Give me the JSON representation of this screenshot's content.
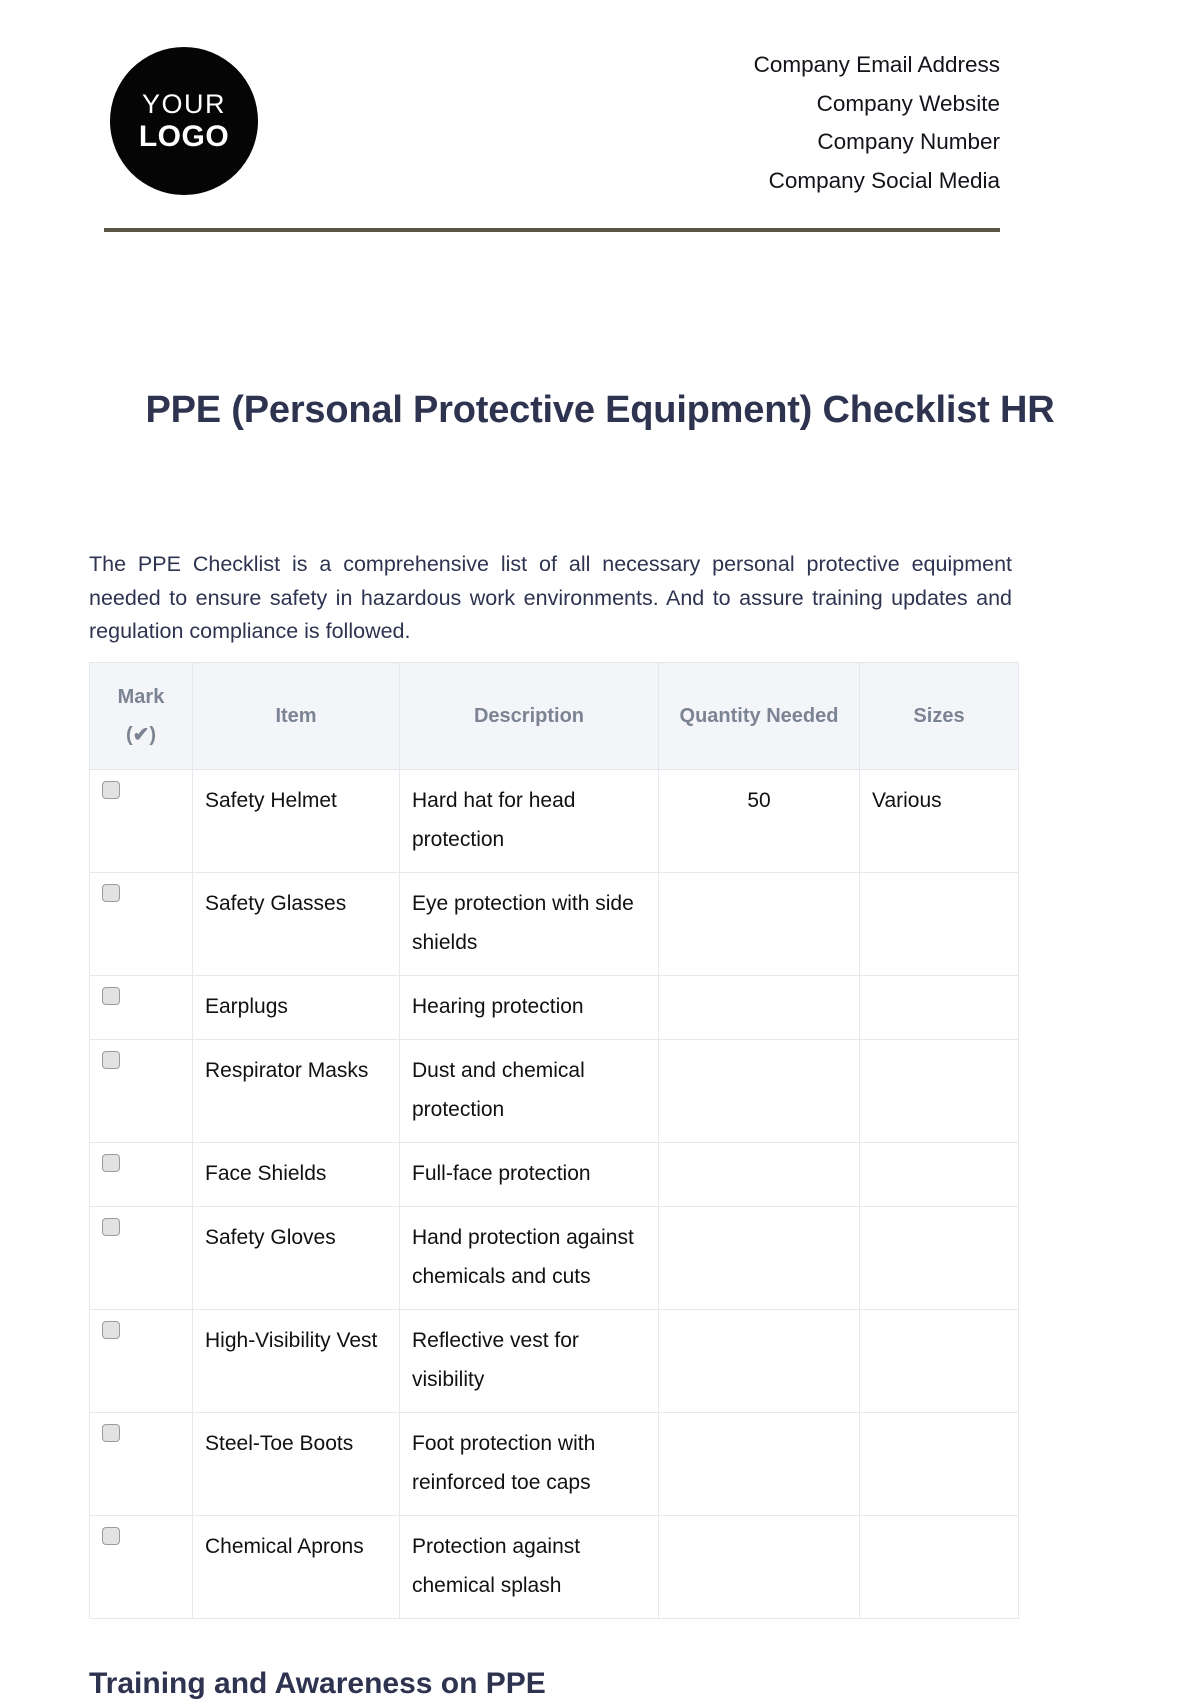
{
  "header": {
    "logo": {
      "line1": "YOUR",
      "line2": "LOGO"
    },
    "contact_lines": [
      "Company Email Address",
      "Company Website",
      "Company Number",
      "Company Social Media"
    ],
    "divider_color": "#585746"
  },
  "document": {
    "title": "PPE (Personal Protective Equipment) Checklist HR",
    "intro": "The PPE Checklist is a comprehensive list of all necessary personal protective equipment needed to ensure safety in hazardous work environments. And to assure training updates and regulation compliance is followed."
  },
  "table": {
    "headers": {
      "mark_line1": "Mark",
      "mark_line2": "(✔)",
      "item": "Item",
      "description": "Description",
      "quantity": "Quantity Needed",
      "sizes": "Sizes"
    },
    "header_bg": "#f4f5f9",
    "header_text_color": "#7c8494",
    "rows": [
      {
        "checked": false,
        "item": "Safety Helmet",
        "description": "Hard hat for head protection",
        "quantity": "50",
        "size": "Various"
      },
      {
        "checked": false,
        "item": "Safety Glasses",
        "description": "Eye protection with side shields",
        "quantity": "",
        "size": ""
      },
      {
        "checked": false,
        "item": "Earplugs",
        "description": "Hearing protection",
        "quantity": "",
        "size": ""
      },
      {
        "checked": false,
        "item": "Respirator Masks",
        "description": "Dust and chemical protection",
        "quantity": "",
        "size": ""
      },
      {
        "checked": false,
        "item": "Face Shields",
        "description": "Full-face protection",
        "quantity": "",
        "size": ""
      },
      {
        "checked": false,
        "item": "Safety Gloves",
        "description": "Hand protection against chemicals and cuts",
        "quantity": "",
        "size": ""
      },
      {
        "checked": false,
        "item": "High-Visibility Vest",
        "description": "Reflective vest for visibility",
        "quantity": "",
        "size": ""
      },
      {
        "checked": false,
        "item": "Steel-Toe Boots",
        "description": "Foot protection with reinforced toe caps",
        "quantity": "",
        "size": ""
      },
      {
        "checked": false,
        "item": "Chemical Aprons",
        "description": "Protection against chemical splash",
        "quantity": "",
        "size": ""
      }
    ]
  },
  "sections": {
    "training_heading": "Training and Awareness on PPE"
  }
}
